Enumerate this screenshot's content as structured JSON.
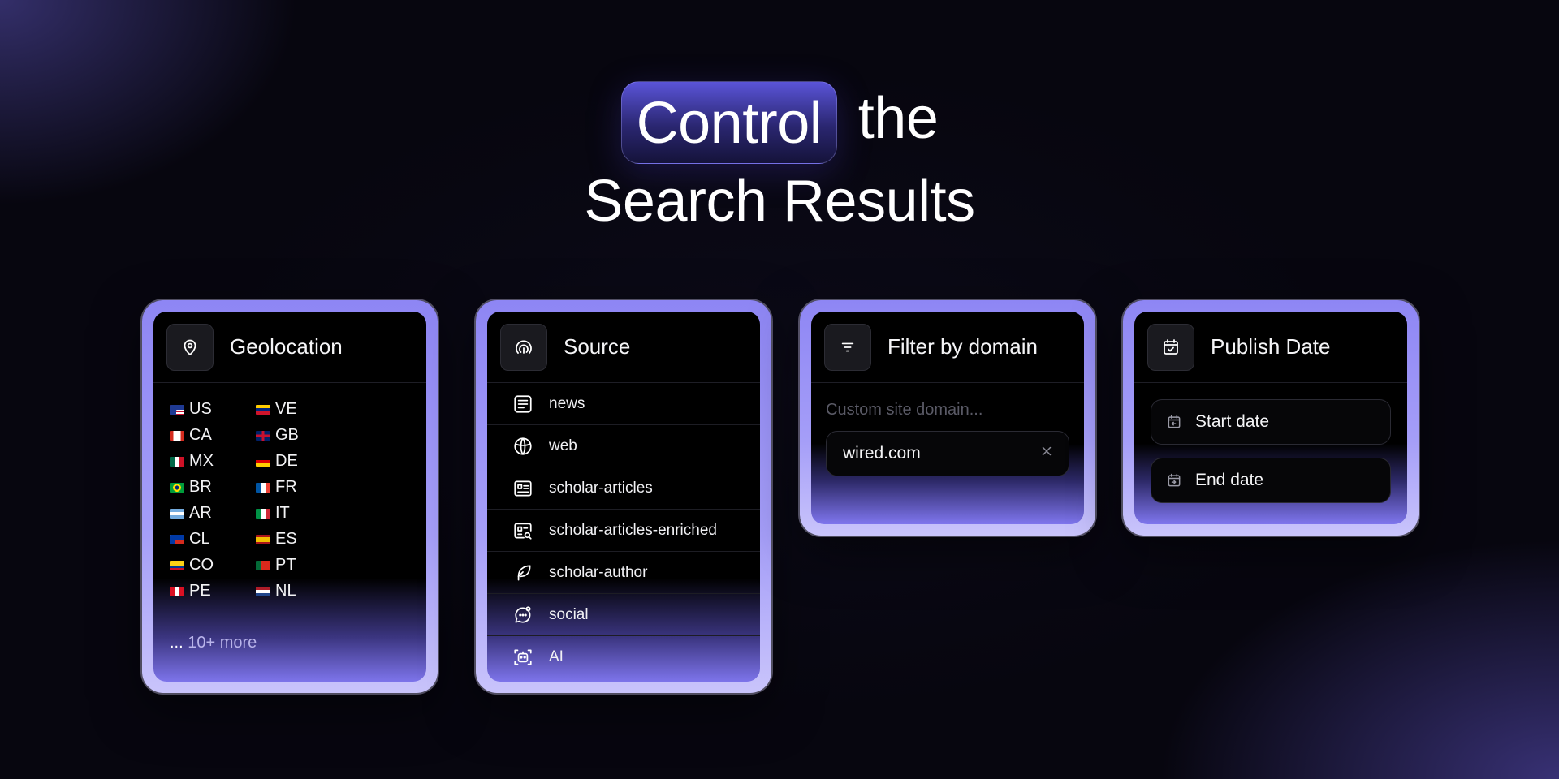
{
  "headline": {
    "highlight": "Control",
    "rest_line1": "the",
    "line2": "Search Results"
  },
  "cards": {
    "geolocation": {
      "title": "Geolocation",
      "icon": "map-pin-icon",
      "countries": [
        "US",
        "CA",
        "MX",
        "BR",
        "AR",
        "CL",
        "CO",
        "PE",
        "VE",
        "GB",
        "DE",
        "FR",
        "IT",
        "ES",
        "PT",
        "NL"
      ],
      "more_prefix": "...",
      "more_label": "10+ more"
    },
    "source": {
      "title": "Source",
      "icon": "source-icon",
      "items": [
        {
          "label": "news",
          "icon": "newspaper-icon"
        },
        {
          "label": "web",
          "icon": "globe-icon"
        },
        {
          "label": "scholar-articles",
          "icon": "article-icon"
        },
        {
          "label": "scholar-articles-enriched",
          "icon": "article-search-icon"
        },
        {
          "label": "scholar-author",
          "icon": "feather-icon"
        },
        {
          "label": "social",
          "icon": "chat-icon"
        },
        {
          "label": "AI",
          "icon": "ai-bot-icon"
        }
      ]
    },
    "filter_domain": {
      "title": "Filter by domain",
      "icon": "filter-icon",
      "placeholder": "Custom site domain...",
      "value": "wired.com"
    },
    "publish_date": {
      "title": "Publish Date",
      "icon": "calendar-check-icon",
      "start_label": "Start date",
      "end_label": "End date"
    }
  }
}
